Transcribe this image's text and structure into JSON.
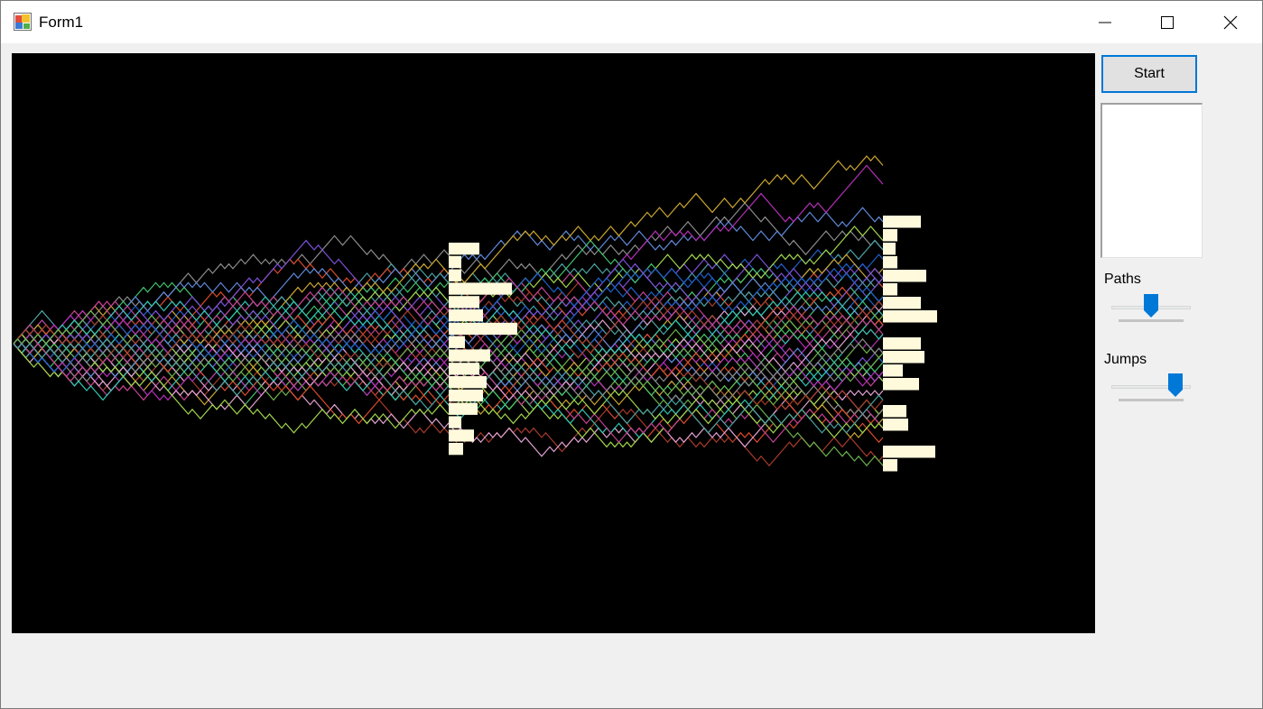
{
  "window": {
    "title": "Form1"
  },
  "icons": {
    "app": "app-icon",
    "minimize": "minimize-icon",
    "maximize": "maximize-icon",
    "close": "close-icon"
  },
  "controls": {
    "start_label": "Start",
    "paths_label": "Paths",
    "jumps_label": "Jumps",
    "paths_slider_fraction": 0.5,
    "jumps_slider_fraction": 0.9
  },
  "colors": {
    "canvas_background": "#000000",
    "histogram": "#fffadc",
    "accent": "#0078d7"
  },
  "simulation": {
    "histograms": [
      {
        "name": "midpoint-histogram",
        "bins": [
          34,
          14,
          14,
          70,
          34,
          38,
          76,
          18,
          46,
          34,
          42,
          38,
          32,
          14,
          28,
          16
        ]
      },
      {
        "name": "endpoint-histogram",
        "bins": [
          42,
          16,
          14,
          16,
          48,
          16,
          42,
          60,
          0,
          42,
          46,
          22,
          40,
          0,
          26,
          28,
          0,
          58,
          16
        ]
      }
    ]
  }
}
